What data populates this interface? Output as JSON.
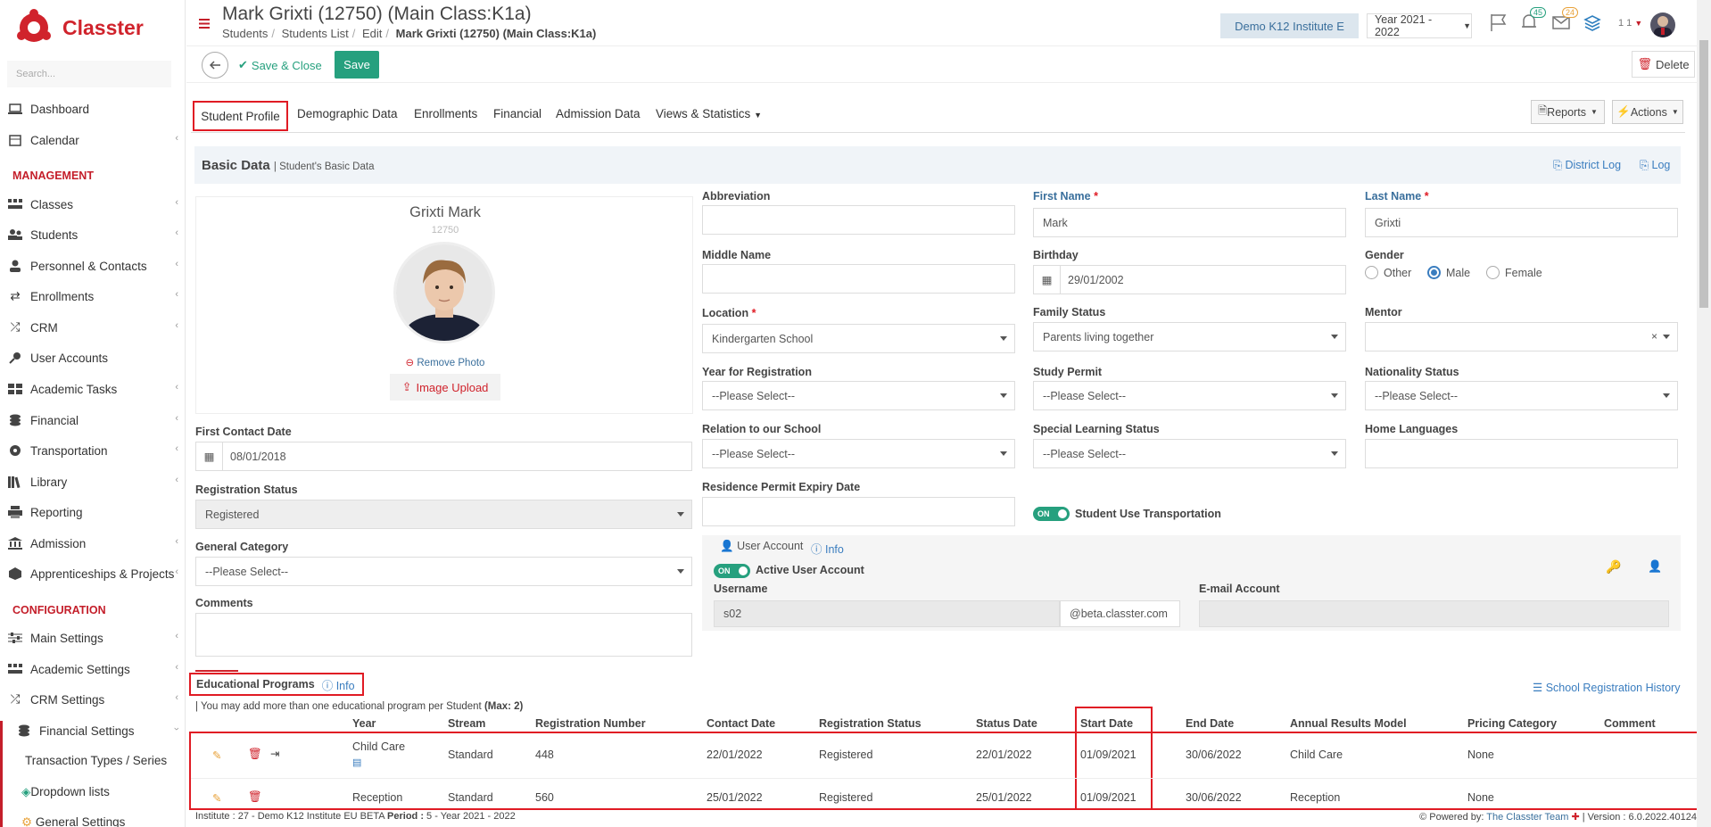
{
  "app": {
    "brand": "Classter",
    "search_placeholder": "Search..."
  },
  "sidebar": {
    "items": [
      {
        "label": "Dashboard",
        "icon": "laptop-icon"
      },
      {
        "label": "Calendar",
        "icon": "calendar-icon"
      },
      {
        "label": "Classes",
        "icon": "classes-icon"
      },
      {
        "label": "Students",
        "icon": "students-icon"
      },
      {
        "label": "Personnel & Contacts",
        "icon": "person-icon"
      },
      {
        "label": "Enrollments",
        "icon": "exchange-icon"
      },
      {
        "label": "CRM",
        "icon": "shuffle-icon"
      },
      {
        "label": "User Accounts",
        "icon": "key-icon"
      },
      {
        "label": "Academic Tasks",
        "icon": "grid-icon"
      },
      {
        "label": "Financial",
        "icon": "coins-icon"
      },
      {
        "label": "Transportation",
        "icon": "dashboard-icon"
      },
      {
        "label": "Library",
        "icon": "books-icon"
      },
      {
        "label": "Reporting",
        "icon": "printer-icon"
      },
      {
        "label": "Admission",
        "icon": "bank-icon"
      },
      {
        "label": "Apprenticeships & Projects",
        "icon": "cube-icon"
      },
      {
        "label": "Main Settings",
        "icon": "sliders-icon"
      },
      {
        "label": "Academic Settings",
        "icon": "classes-icon"
      },
      {
        "label": "CRM Settings",
        "icon": "shuffle-icon"
      },
      {
        "label": "Financial Settings",
        "icon": "coins-icon"
      }
    ],
    "section_management": "MANAGEMENT",
    "section_configuration": "CONFIGURATION",
    "sub_items": [
      "Transaction Types / Series",
      "Dropdown lists",
      "General Settings"
    ]
  },
  "header": {
    "title": "Mark Grixti (12750) (Main Class:K1a)",
    "breadcrumb": [
      "Students",
      "Students List",
      "Edit",
      "Mark Grixti (12750) (Main Class:K1a)"
    ],
    "institute": "Demo K12 Institute E",
    "year": "Year 2021 - 2022",
    "notif_count": "45",
    "mail_count": "24",
    "user_short": "1 1"
  },
  "toolbar": {
    "save_close": "Save & Close",
    "save": "Save",
    "delete": "Delete"
  },
  "tabs": [
    "Student Profile",
    "Demographic Data",
    "Enrollments",
    "Financial",
    "Admission Data",
    "Views & Statistics"
  ],
  "actions": {
    "reports": "Reports",
    "actions": "Actions"
  },
  "basic": {
    "title": "Basic Data",
    "subtitle": "| Student's Basic Data",
    "district_log": "District Log",
    "log": "Log"
  },
  "profile": {
    "name": "Grixti Mark",
    "id": "12750",
    "remove_photo": "Remove Photo",
    "image_upload": "Image Upload"
  },
  "form": {
    "abbreviation": {
      "label": "Abbreviation",
      "value": ""
    },
    "first_name": {
      "label": "First Name",
      "value": "Mark"
    },
    "last_name": {
      "label": "Last Name",
      "value": "Grixti"
    },
    "middle_name": {
      "label": "Middle Name",
      "value": ""
    },
    "birthday": {
      "label": "Birthday",
      "value": "29/01/2002"
    },
    "gender": {
      "label": "Gender",
      "options": [
        "Other",
        "Male",
        "Female"
      ],
      "selected": "Male"
    },
    "location": {
      "label": "Location",
      "value": "Kindergarten School"
    },
    "family_status": {
      "label": "Family Status",
      "value": "Parents living together"
    },
    "mentor": {
      "label": "Mentor",
      "value": ""
    },
    "year_registration": {
      "label": "Year for Registration",
      "value": "--Please Select--"
    },
    "study_permit": {
      "label": "Study Permit",
      "value": "--Please Select--"
    },
    "nationality_status": {
      "label": "Nationality Status",
      "value": "--Please Select--"
    },
    "first_contact": {
      "label": "First Contact Date",
      "value": "08/01/2018"
    },
    "relation_school": {
      "label": "Relation to our School",
      "value": "--Please Select--"
    },
    "special_learning": {
      "label": "Special Learning Status",
      "value": "--Please Select--"
    },
    "home_languages": {
      "label": "Home Languages",
      "value": ""
    },
    "registration_status": {
      "label": "Registration Status",
      "value": "Registered"
    },
    "residence_permit": {
      "label": "Residence Permit Expiry Date",
      "value": ""
    },
    "transportation": {
      "label": "Student Use Transportation",
      "toggle": "ON"
    },
    "general_category": {
      "label": "General Category",
      "value": "--Please Select--"
    },
    "comments": {
      "label": "Comments",
      "value": ""
    }
  },
  "user_account": {
    "title": "User Account",
    "info": "Info",
    "active_label": "Active User Account",
    "toggle": "ON",
    "username_label": "Username",
    "username": "s02",
    "domain": "@beta.classter.com",
    "email_label": "E-mail Account",
    "email": ""
  },
  "edu": {
    "title": "Educational Programs",
    "info": "Info",
    "history": "School Registration History",
    "note": "| You may add more than one educational program per Student",
    "note_max": "(Max: 2)",
    "columns": [
      "Year",
      "Stream",
      "Registration Number",
      "Contact Date",
      "Registration Status",
      "Status Date",
      "Start Date",
      "End Date",
      "Annual Results Model",
      "Pricing Category",
      "Comment"
    ],
    "rows": [
      [
        "Child Care",
        "Standard",
        "448",
        "22/01/2022",
        "Registered",
        "22/01/2022",
        "01/09/2021",
        "30/06/2022",
        "Child Care",
        "None",
        ""
      ],
      [
        "Reception",
        "Standard",
        "560",
        "25/01/2022",
        "Registered",
        "25/01/2022",
        "01/09/2021",
        "30/06/2022",
        "Reception",
        "None",
        ""
      ]
    ]
  },
  "footer": {
    "left_inst_label": "Institute :",
    "left_inst": "27 - Demo K12 Institute EU BETA",
    "left_period_label": "Period :",
    "left_period": "5 - Year 2021 - 2022",
    "powered": "Powered by:",
    "team": "The Classter Team",
    "version": "| Version : 6.0.2022.40124"
  }
}
